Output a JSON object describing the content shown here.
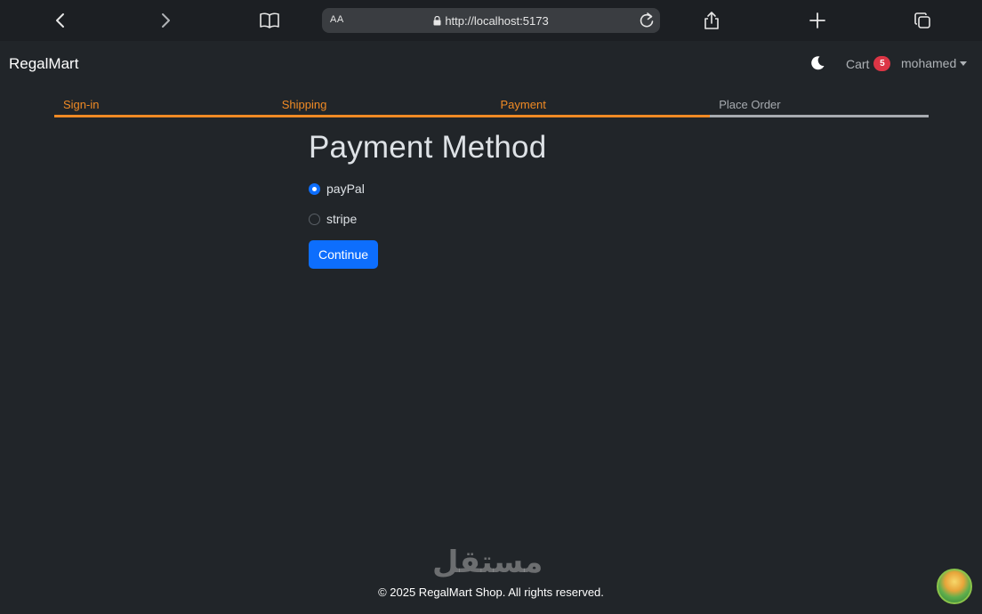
{
  "browser": {
    "text_size_label": "AA",
    "url": "http://localhost:5173"
  },
  "navbar": {
    "brand": "RegalMart",
    "cart_label": "Cart",
    "cart_count": "5",
    "user_name": "mohamed"
  },
  "steps": [
    {
      "label": "Sign-in",
      "state": "completed"
    },
    {
      "label": "Shipping",
      "state": "completed"
    },
    {
      "label": "Payment",
      "state": "active"
    },
    {
      "label": "Place Order",
      "state": "pending"
    }
  ],
  "form": {
    "title": "Payment Method",
    "options": [
      {
        "label": "payPal",
        "selected": true
      },
      {
        "label": "stripe",
        "selected": false
      }
    ],
    "submit_label": "Continue"
  },
  "footer": {
    "copyright": "© 2025 RegalMart Shop. All rights reserved."
  },
  "watermark": "مستقل",
  "colors": {
    "accent_step": "#f08a24",
    "primary": "#0d6efd",
    "badge": "#dc3545",
    "background": "#212529"
  }
}
